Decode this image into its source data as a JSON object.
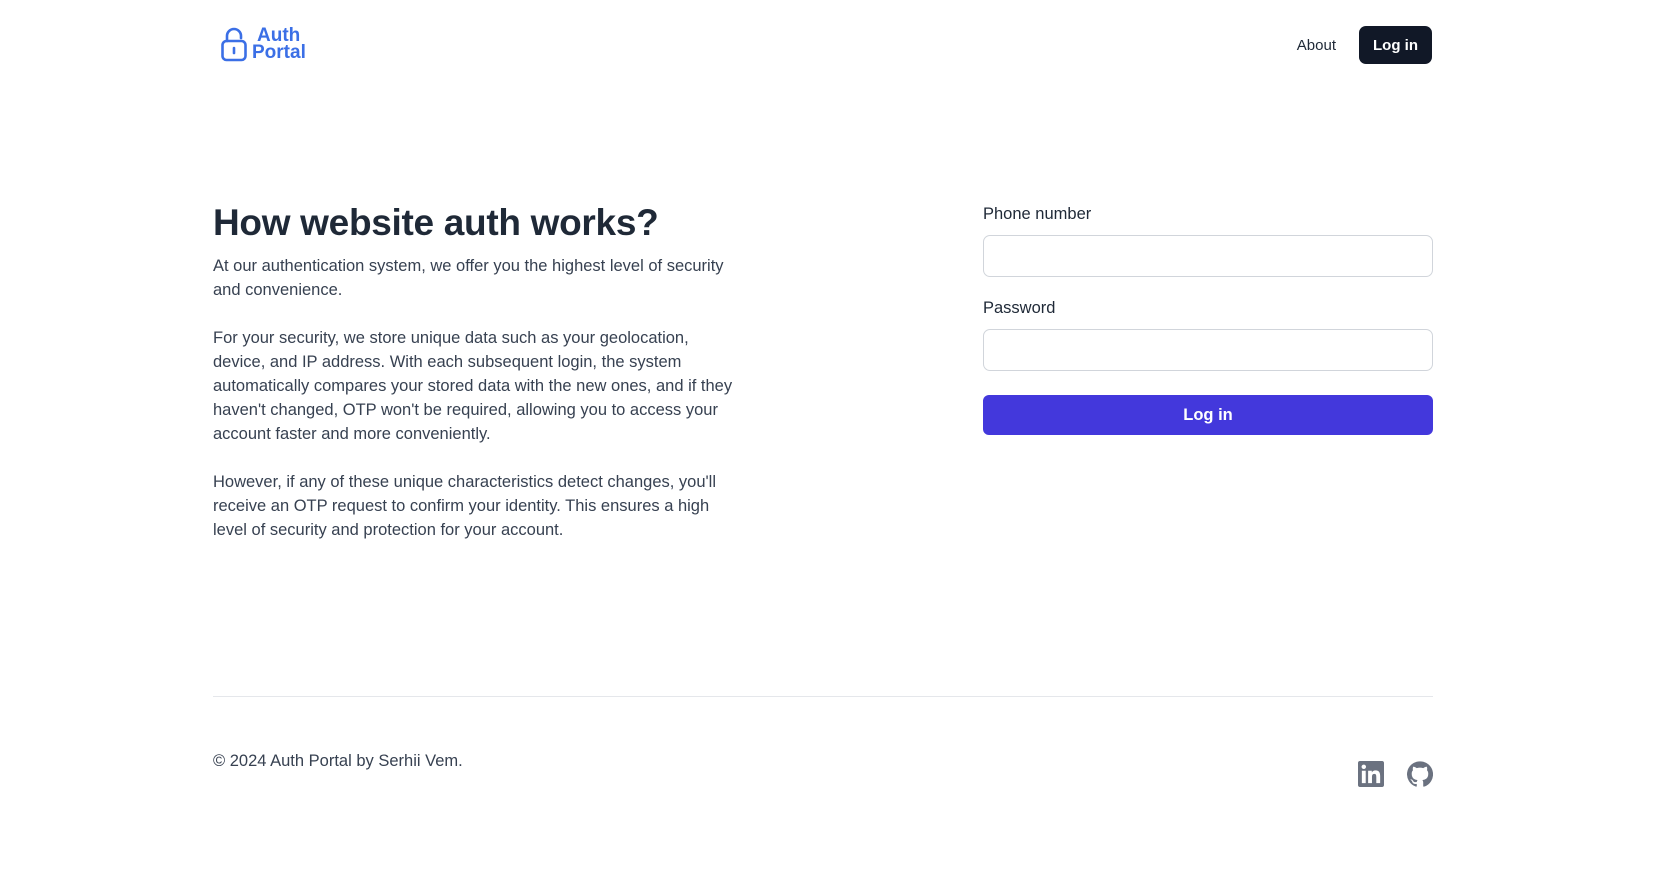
{
  "header": {
    "logo": {
      "line1": "Auth",
      "line2": "Portal",
      "icon": "lock-icon",
      "color": "#3b6fe6"
    },
    "nav": {
      "about_label": "About",
      "login_label": "Log in"
    }
  },
  "info": {
    "title": "How website auth works?",
    "paragraphs": [
      "At our authentication system, we offer you the highest level of security and convenience.",
      "For your security, we store unique data such as your geolocation, device, and IP address. With each subsequent login, the system automatically compares your stored data with the new ones, and if they haven't changed, OTP won't be required, allowing you to access your account faster and more conveniently.",
      "However, if any of these unique characteristics detect changes, you'll receive an OTP request to confirm your identity. This ensures a high level of security and protection for your account."
    ]
  },
  "form": {
    "phone": {
      "label": "Phone number",
      "value": "",
      "placeholder": ""
    },
    "password": {
      "label": "Password",
      "value": "",
      "placeholder": ""
    },
    "submit_label": "Log in",
    "submit_color": "#4338dc"
  },
  "footer": {
    "copyright": "© 2024 Auth Portal by Serhii Vem.",
    "socials": [
      {
        "icon": "linkedin-icon"
      },
      {
        "icon": "github-icon"
      }
    ]
  }
}
